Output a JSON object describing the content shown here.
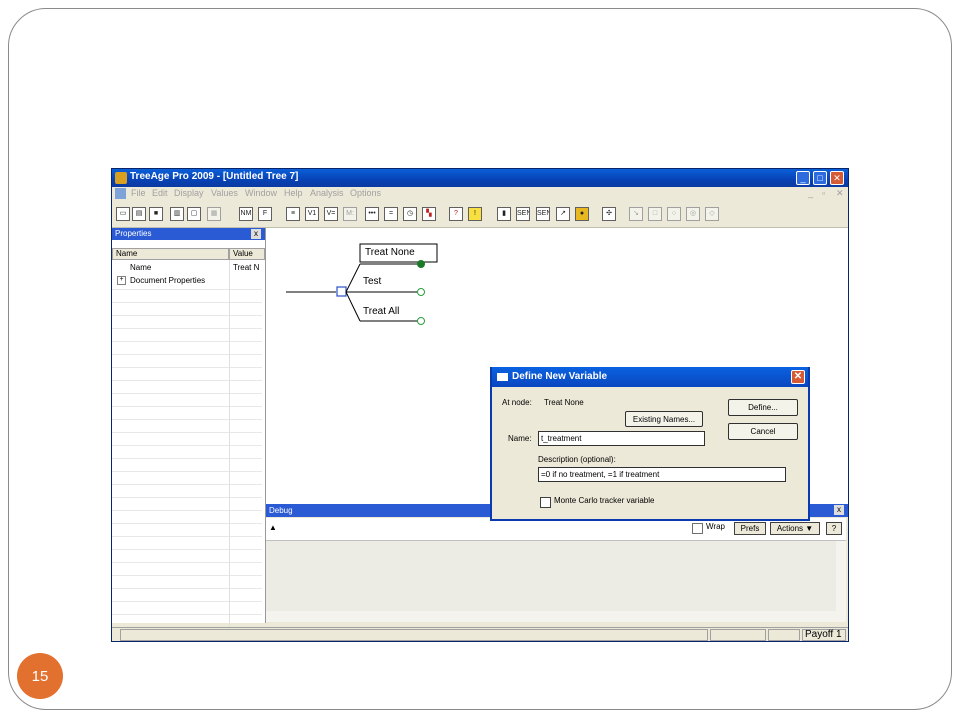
{
  "slide": {
    "page_number": "15"
  },
  "app": {
    "title": "TreeAge Pro 2009 - [Untitled Tree 7]",
    "menu": [
      "File",
      "Edit",
      "Display",
      "Values",
      "Window",
      "Help",
      "Analysis",
      "Options"
    ],
    "mdi_controls": {
      "minimize": "_",
      "restore": "▫",
      "close": "✕"
    }
  },
  "toolbar": {
    "tools": [
      "new-document-icon",
      "open-folder-icon",
      "save-disk-icon",
      "print-icon",
      "print-preview-icon",
      "page-setup-icon",
      "define-names-icon",
      "formula-icon",
      "tree-layout-icon",
      "variable-properties-icon",
      "variable-list-icon",
      "markov-icon",
      "more-icon",
      "equal-icon",
      "clock-icon",
      "color-node-icon",
      "warning-icon",
      "alert-icon",
      "chart-bar-icon",
      "sensitivity-icon",
      "sensitivity-2-icon",
      "arrow-cursor-icon",
      "color-wheel-icon",
      "move-cursor-icon",
      "line-tool-icon",
      "square-tool-icon",
      "circle-tool-icon",
      "circle-node-tool-icon",
      "diamond-tool-icon"
    ],
    "labels": {
      "names": "NM",
      "sens1": "SENS",
      "sens2": "SENS",
      "var": "V=",
      "markov": "M:",
      "more": "•••",
      "eq": "=",
      "formula": "F",
      "vars": "V1"
    }
  },
  "properties": {
    "header": "Properties",
    "close": "x",
    "columns": [
      "Name",
      "Value"
    ],
    "rows": [
      {
        "name": "Name",
        "value": "Treat N"
      },
      {
        "name": "Document Properties",
        "value": ""
      }
    ],
    "expand_symbol": "+"
  },
  "tree": {
    "branches": [
      "Treat None",
      "Test",
      "Treat All"
    ]
  },
  "debug": {
    "header": "Debug",
    "close": "x",
    "wrap_label": "Wrap",
    "prefs_label": "Prefs",
    "actions_label": "Actions ▼",
    "help_label": "?"
  },
  "status": {
    "payoff": "Payoff 1"
  },
  "dialog": {
    "title": "Define New Variable",
    "at_node_label": "At node:",
    "at_node_value": "Treat None",
    "existing_names_label": "Existing Names...",
    "define_label": "Define...",
    "cancel_label": "Cancel",
    "name_label": "Name:",
    "name_value": "t_treatment",
    "description_label": "Description (optional):",
    "description_value": "=0 if no treatment, =1 if treatment",
    "tracker_label": "Monte Carlo tracker variable"
  },
  "colors": {
    "titlebar": "#0a5fd8",
    "dialog_close": "#d65a33",
    "slide_accent": "#e2702e",
    "decision_node": "#2a50c8",
    "chance_node": "#2aa040",
    "terminal_node": "#1a7a2a"
  }
}
